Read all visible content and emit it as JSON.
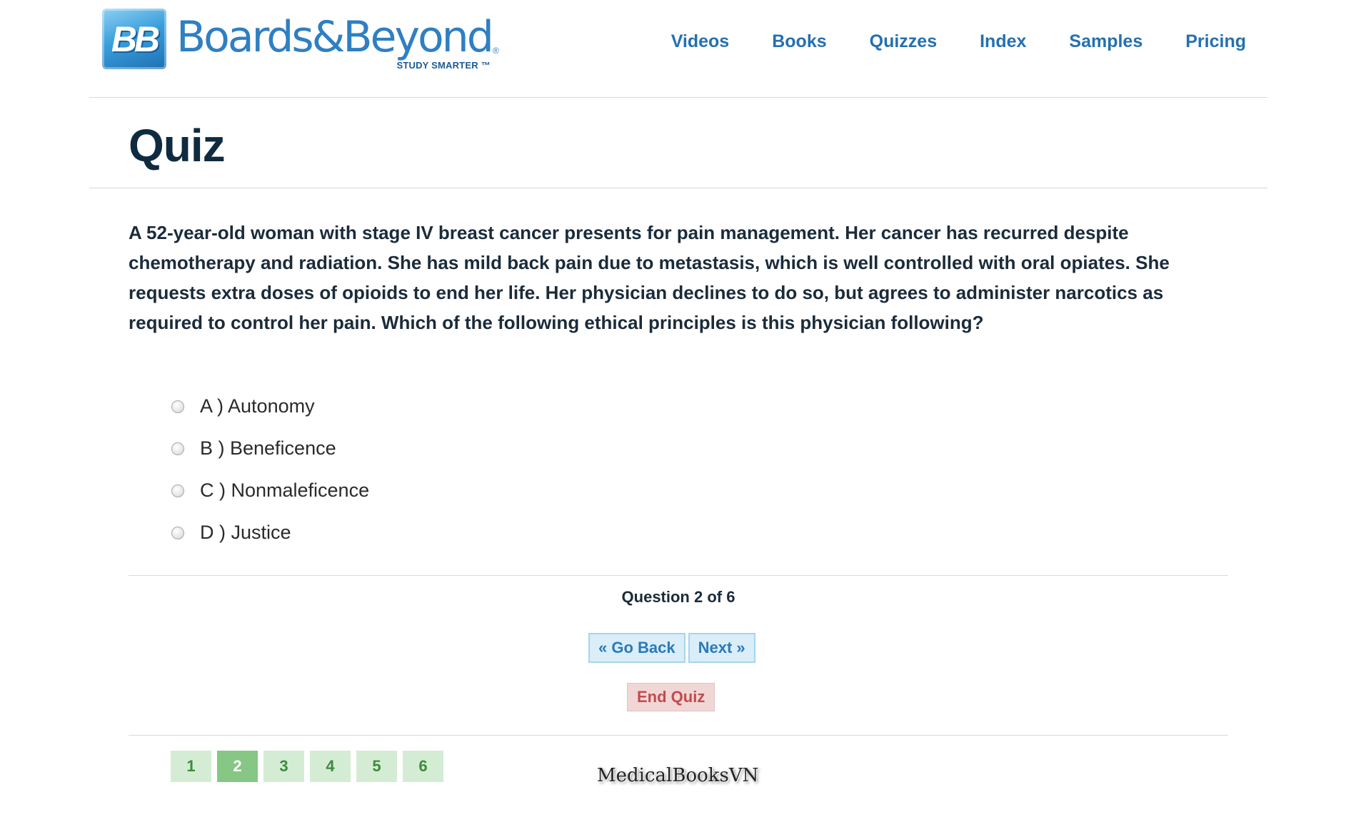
{
  "brand": {
    "logo_mark": "BB",
    "name": "Boards&Beyond",
    "registered": "®",
    "tagline": "STUDY SMARTER ™"
  },
  "nav": {
    "items": [
      {
        "label": "Videos"
      },
      {
        "label": "Books"
      },
      {
        "label": "Quizzes"
      },
      {
        "label": "Index"
      },
      {
        "label": "Samples"
      },
      {
        "label": "Pricing"
      }
    ]
  },
  "page": {
    "title": "Quiz"
  },
  "quiz": {
    "question": "A 52-year-old woman with stage IV breast cancer presents for pain management. Her cancer has recurred despite chemotherapy and radiation. She has mild back pain due to metastasis, which is well controlled with oral opiates. She requests extra doses of opioids to end her life. Her physician declines to do so, but agrees to administer narcotics as required to control her pain. Which of the following ethical principles is this physician following?",
    "options": [
      {
        "label": "A ) Autonomy"
      },
      {
        "label": "B ) Beneficence"
      },
      {
        "label": "C ) Nonmaleficence"
      },
      {
        "label": "D ) Justice"
      }
    ],
    "progress": "Question 2 of 6",
    "back_label": "« Go Back",
    "next_label": "Next »",
    "end_label": "End Quiz",
    "pages": [
      "1",
      "2",
      "3",
      "4",
      "5",
      "6"
    ],
    "current_page": 2
  },
  "watermark": "MedicalBooksVN",
  "colors": {
    "nav_link": "#2470b0",
    "title": "#0f2b3f",
    "nav_button_bg": "#d9eef9",
    "end_button_text": "#c24b4b",
    "page_button_bg": "#d4ecd4",
    "page_button_active": "#86c786"
  }
}
